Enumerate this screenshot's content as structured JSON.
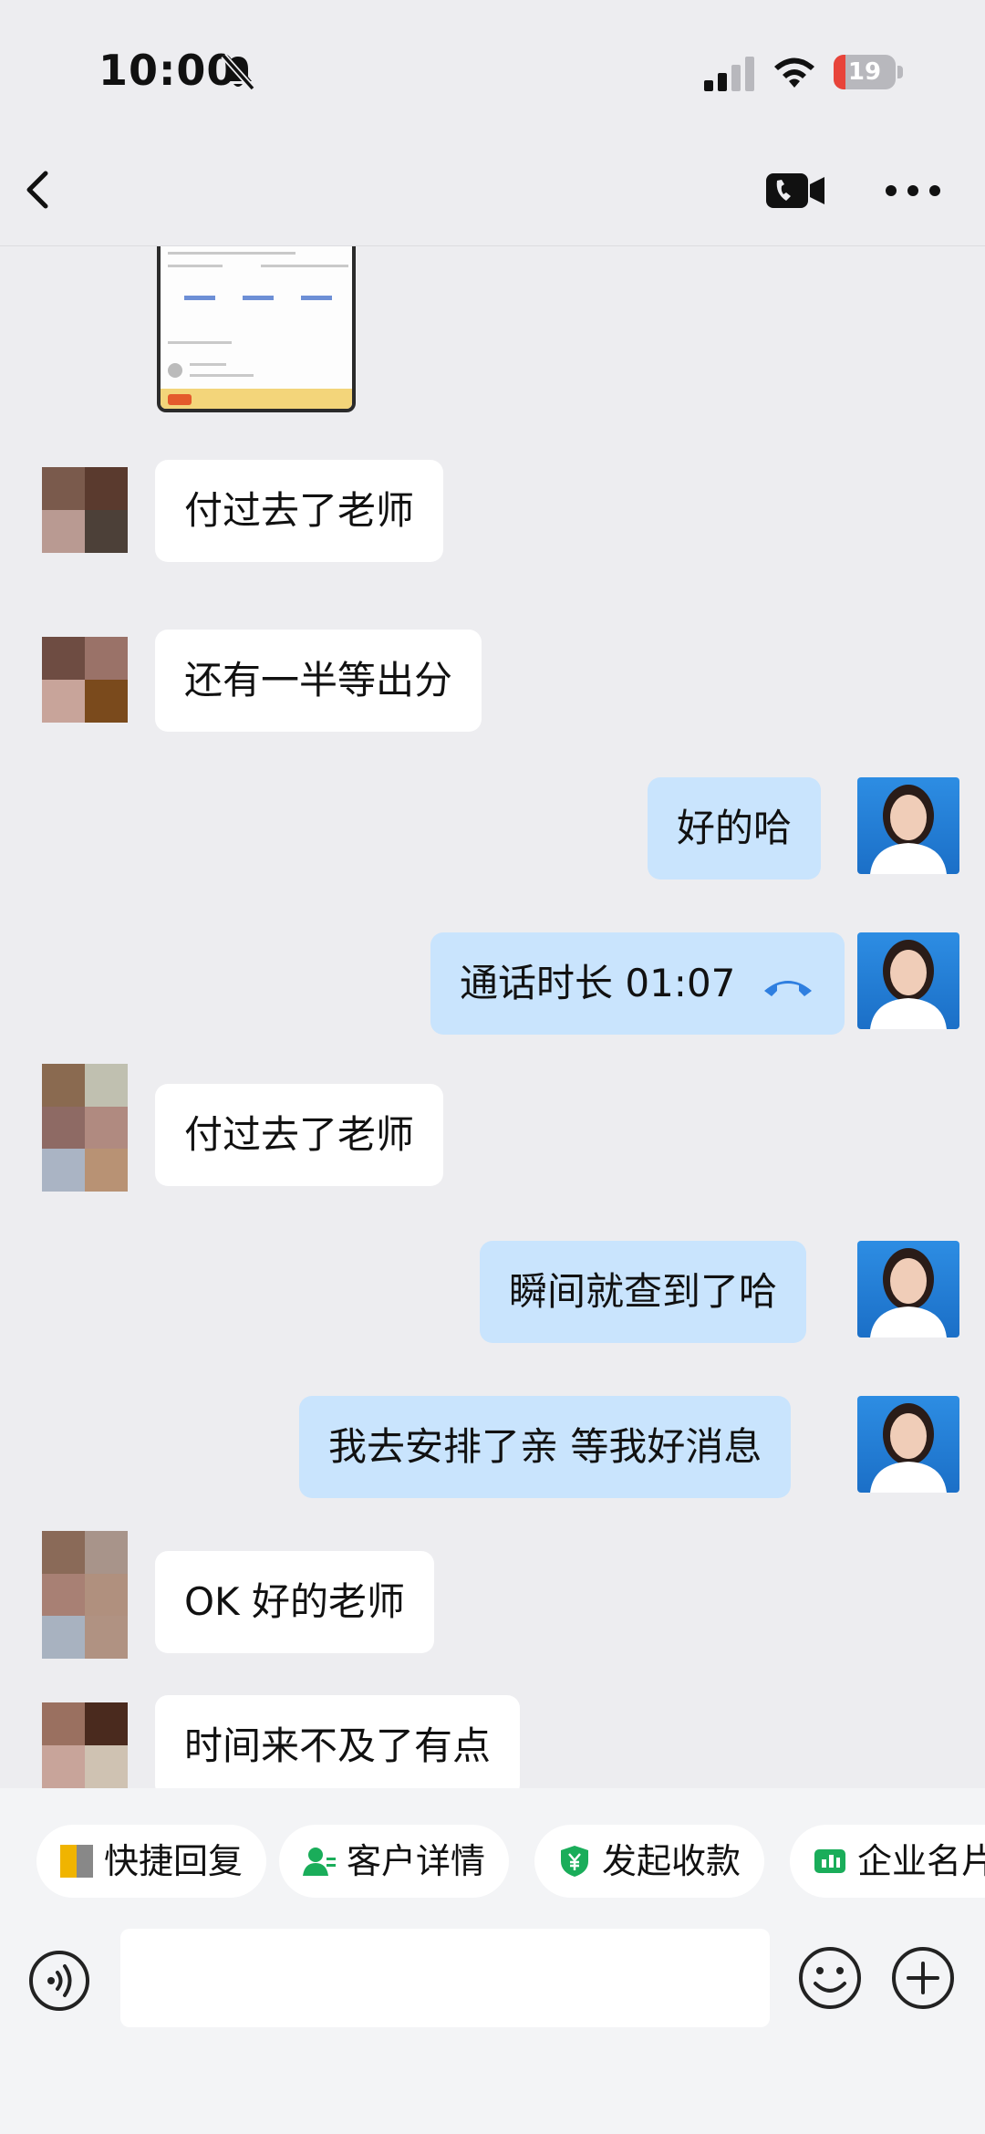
{
  "status_bar": {
    "time": "10:00",
    "battery": "19",
    "battery_level": 0.19,
    "icons": [
      "bell-muted-icon",
      "signal-icon",
      "wifi-icon",
      "battery-charging-icon"
    ]
  },
  "nav": {
    "icons": [
      "back-icon",
      "phone-video-icon",
      "more-icon"
    ]
  },
  "messages": [
    {
      "side": "in",
      "text": "付过去了老师"
    },
    {
      "side": "in",
      "text": "还有一半等出分"
    },
    {
      "side": "out",
      "text": "好的哈"
    },
    {
      "side": "out",
      "text": "通话时长 01:07",
      "icon": "phone-hangup-icon"
    },
    {
      "side": "in",
      "text": "付过去了老师"
    },
    {
      "side": "out",
      "text": "瞬间就查到了哈"
    },
    {
      "side": "out",
      "text": "我去安排了亲 等我好消息"
    },
    {
      "side": "in",
      "text": "OK 好的老师"
    },
    {
      "side": "in",
      "text": "时间来不及了有点"
    }
  ],
  "quick_actions": [
    {
      "label": "快捷回复",
      "icon": "quick-reply-icon"
    },
    {
      "label": "客户详情",
      "icon": "customer-detail-icon"
    },
    {
      "label": "发起收款",
      "icon": "yuan-shield-icon"
    },
    {
      "label": "企业名片",
      "icon": "business-card-icon"
    }
  ],
  "input": {
    "placeholder": "",
    "icons": [
      "voice-icon",
      "emoji-icon",
      "plus-icon"
    ]
  },
  "colors": {
    "background": "#ededf0",
    "incoming_bubble": "#ffffff",
    "outgoing_bubble": "#c9e4fd",
    "accent_green": "#1aad5a",
    "battery_low": "#e8443a",
    "call_icon": "#2f7fe0"
  }
}
